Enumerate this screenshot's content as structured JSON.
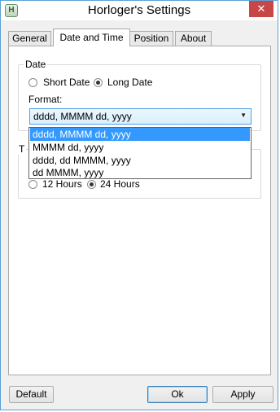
{
  "window": {
    "title": "Horloger's Settings",
    "icon_letter": "H",
    "close_glyph": "✕"
  },
  "tabs": [
    {
      "label": "General",
      "active": false
    },
    {
      "label": "Date and Time",
      "active": true
    },
    {
      "label": "Position",
      "active": false
    },
    {
      "label": "About",
      "active": false
    }
  ],
  "date_group": {
    "legend": "Date",
    "options": [
      {
        "label": "Short Date",
        "checked": false
      },
      {
        "label": "Long Date",
        "checked": true
      }
    ],
    "format_label": "Format:",
    "format_value": "dddd, MMMM dd, yyyy",
    "format_options": [
      "dddd, MMMM dd, yyyy",
      "MMMM dd, yyyy",
      "dddd, dd MMMM, yyyy",
      "dd MMMM, yyyy"
    ],
    "selected_index": 0
  },
  "time_group": {
    "legend": "T",
    "options": [
      {
        "label": "12 Hours",
        "checked": false
      },
      {
        "label": "24 Hours",
        "checked": true
      }
    ]
  },
  "buttons": {
    "default_label": "Default",
    "ok_label": "Ok",
    "apply_label": "Apply"
  },
  "colors": {
    "selection": "#3399ff",
    "close_button": "#c74646",
    "window_border": "#5ba2d6"
  }
}
